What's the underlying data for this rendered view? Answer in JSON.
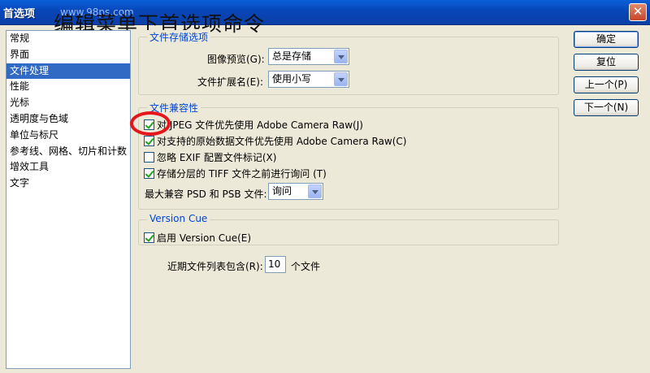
{
  "window": {
    "title": "首选项",
    "watermark": "www.98ps.com",
    "overlay_caption": "编辑菜单下首选项命令",
    "close_glyph": "✕"
  },
  "categories": [
    {
      "label": "常规",
      "selected": false
    },
    {
      "label": "界面",
      "selected": false
    },
    {
      "label": "文件处理",
      "selected": true
    },
    {
      "label": "性能",
      "selected": false
    },
    {
      "label": "光标",
      "selected": false
    },
    {
      "label": "透明度与色域",
      "selected": false
    },
    {
      "label": "单位与标尺",
      "selected": false
    },
    {
      "label": "参考线、网格、切片和计数",
      "selected": false
    },
    {
      "label": "增效工具",
      "selected": false
    },
    {
      "label": "文字",
      "selected": false
    }
  ],
  "file_save": {
    "legend": "文件存储选项",
    "preview_label": "图像预览(G):",
    "preview_value": "总是存储",
    "ext_label": "文件扩展名(E):",
    "ext_value": "使用小写"
  },
  "compat": {
    "legend": "文件兼容性",
    "options": [
      {
        "label": "对 JPEG 文件优先使用 Adobe Camera Raw(J)",
        "checked": true
      },
      {
        "label": "对支持的原始数据文件优先使用 Adobe Camera Raw(C)",
        "checked": true
      },
      {
        "label": "忽略 EXIF 配置文件标记(X)",
        "checked": false
      },
      {
        "label": "存储分层的 TIFF 文件之前进行询问 (T)",
        "checked": true
      }
    ],
    "max_label": "最大兼容 PSD 和 PSB 文件:",
    "max_value": "询问"
  },
  "version_cue": {
    "legend": "Version Cue",
    "enable_label": "启用 Version Cue(E)",
    "checked": true
  },
  "recent": {
    "label": "近期文件列表包含(R):",
    "value": "10",
    "suffix": "个文件"
  },
  "buttons": {
    "ok": "确定",
    "reset": "复位",
    "prev": "上一个(P)",
    "next": "下一个(N)"
  },
  "colors": {
    "accent": "#316ac5",
    "legend": "#0046d5",
    "annotation": "#e5161b"
  }
}
